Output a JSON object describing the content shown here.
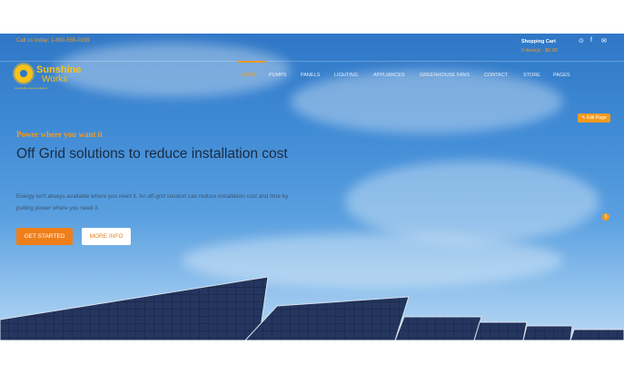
{
  "topbar": {
    "phone": "Call us today: 1-800-555-0199",
    "cart_title": "Shopping Cart",
    "cart_sub": "0 item(s) - $0.00",
    "social": [
      "pinterest-icon",
      "facebook-icon",
      "email-icon"
    ]
  },
  "logo": {
    "line1": "Sunshine",
    "line2": "Works",
    "line3": "renewable energy solutions"
  },
  "nav": {
    "items": [
      "HOME",
      "PUMPS",
      "PANELS",
      "LIGHTING",
      "APPLIANCES",
      "GREENHOUSE FANS",
      "CONTACT",
      "STORE",
      "PAGES"
    ],
    "active": "HOME",
    "edit_label": "Edit Page"
  },
  "hero": {
    "tagline": "Power where you want it",
    "headline": "Off Grid solutions to reduce installation cost",
    "description": "Energy isn't always available where you need it. An off-grid solution can reduce installation cost and time by putting power where you need it.",
    "btn_start": "GET STARTED",
    "btn_more": "MORE INFO",
    "slide_indicator": "1"
  },
  "colors": {
    "accent": "#f39a1e",
    "button": "#f07f1a",
    "sky": "#3f8ad5",
    "headline": "#1b2b40"
  }
}
